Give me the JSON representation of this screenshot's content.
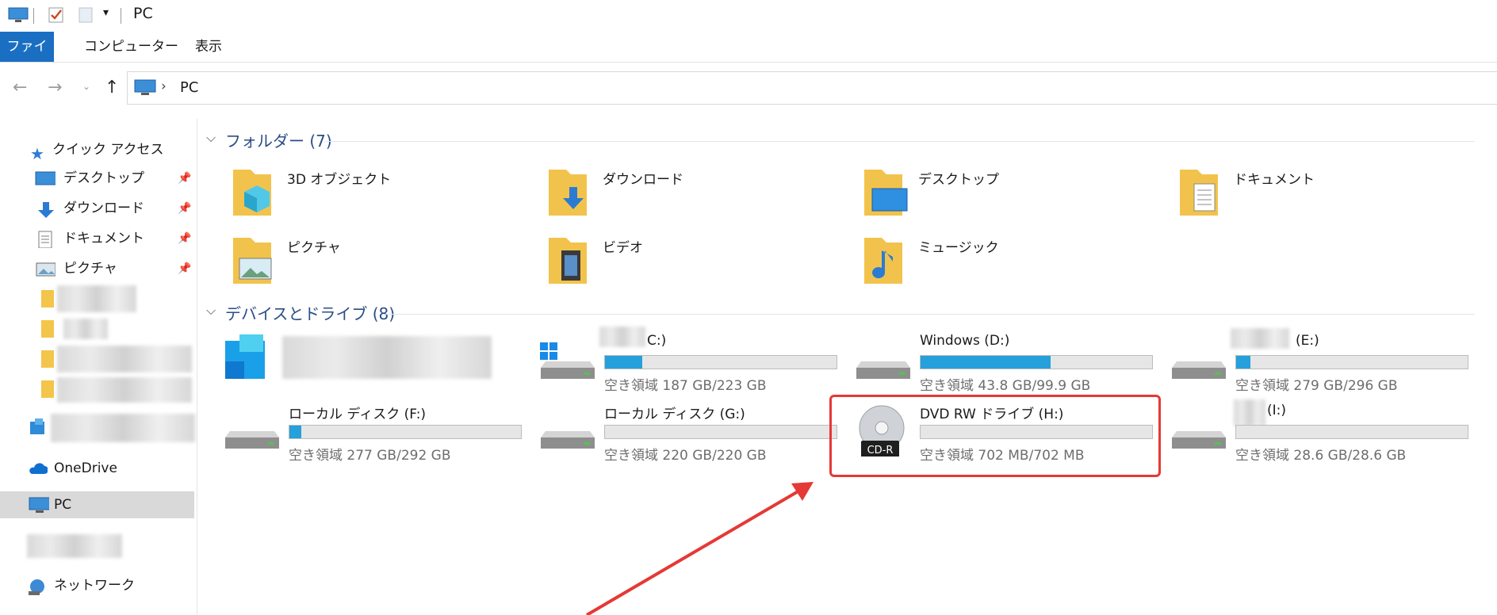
{
  "window": {
    "title": "PC"
  },
  "ribbon": {
    "tabs": [
      "ファイル",
      "コンピューター",
      "表示"
    ]
  },
  "address": {
    "crumb": "PC"
  },
  "sidebar": {
    "quick_access": "クイック アクセス",
    "items": [
      {
        "label": "デスクトップ",
        "icon": "desktop-icon"
      },
      {
        "label": "ダウンロード",
        "icon": "download-arrow-icon"
      },
      {
        "label": "ドキュメント",
        "icon": "document-icon"
      },
      {
        "label": "ピクチャ",
        "icon": "picture-icon"
      }
    ],
    "onedrive": "OneDrive",
    "pc": "PC",
    "network": "ネットワーク"
  },
  "sections": {
    "folders": "フォルダー (7)",
    "drives": "デバイスとドライブ (8)"
  },
  "folders": [
    {
      "label": "3D オブジェクト",
      "icon": "3d-objects-folder-icon"
    },
    {
      "label": "ダウンロード",
      "icon": "downloads-folder-icon"
    },
    {
      "label": "デスクトップ",
      "icon": "desktop-folder-icon"
    },
    {
      "label": "ドキュメント",
      "icon": "documents-folder-icon"
    },
    {
      "label": "ピクチャ",
      "icon": "pictures-folder-icon"
    },
    {
      "label": "ビデオ",
      "icon": "videos-folder-icon"
    },
    {
      "label": "ミュージック",
      "icon": "music-folder-icon"
    }
  ],
  "drives": [
    {
      "name": "",
      "free": "",
      "used_fraction": null
    },
    {
      "name": "C:)",
      "free": "空き領域 187 GB/223 GB",
      "used_fraction": 0.16
    },
    {
      "name": "Windows (D:)",
      "free": "空き領域 43.8 GB/99.9 GB",
      "used_fraction": 0.56
    },
    {
      "name": "(E:)",
      "free": "空き領域 279 GB/296 GB",
      "used_fraction": 0.06
    },
    {
      "name": "ローカル ディスク (F:)",
      "free": "空き領域 277 GB/292 GB",
      "used_fraction": 0.05
    },
    {
      "name": "ローカル ディスク (G:)",
      "free": "空き領域 220 GB/220 GB",
      "used_fraction": 0.0
    },
    {
      "name": "DVD RW ドライブ (H:)",
      "free": "空き領域 702 MB/702 MB",
      "used_fraction": 0.0,
      "disc_label": "CD-R"
    },
    {
      "name": "(I:)",
      "free": "空き領域 28.6 GB/28.6 GB",
      "used_fraction": 0.0
    }
  ],
  "colors": {
    "accent": "#1a6fc2",
    "drive_fill": "#26a0da",
    "highlight": "#e53935"
  }
}
